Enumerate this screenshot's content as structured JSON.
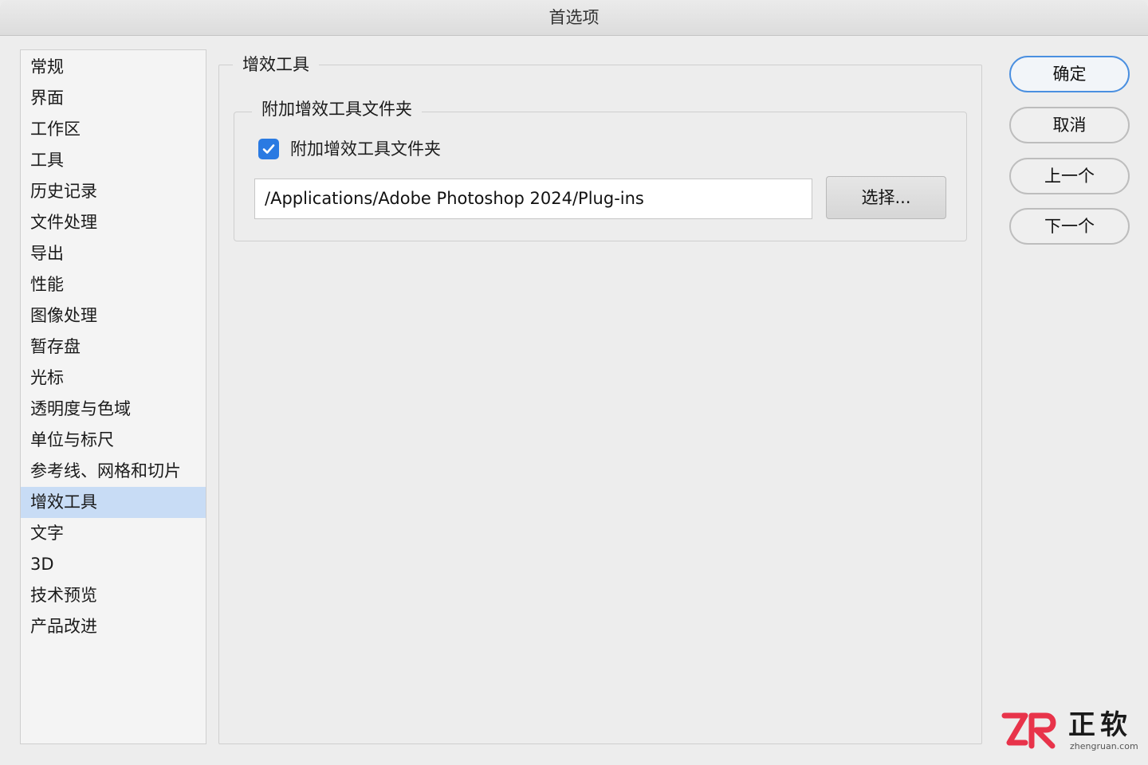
{
  "window": {
    "title": "首选项"
  },
  "sidebar": {
    "items": [
      {
        "label": "常规"
      },
      {
        "label": "界面"
      },
      {
        "label": "工作区"
      },
      {
        "label": "工具"
      },
      {
        "label": "历史记录"
      },
      {
        "label": "文件处理"
      },
      {
        "label": "导出"
      },
      {
        "label": "性能"
      },
      {
        "label": "图像处理"
      },
      {
        "label": "暂存盘"
      },
      {
        "label": "光标"
      },
      {
        "label": "透明度与色域"
      },
      {
        "label": "单位与标尺"
      },
      {
        "label": "参考线、网格和切片"
      },
      {
        "label": "增效工具"
      },
      {
        "label": "文字"
      },
      {
        "label": "3D"
      },
      {
        "label": "技术预览"
      },
      {
        "label": "产品改进"
      }
    ],
    "selected_index": 14
  },
  "main": {
    "group_title": "增效工具",
    "sub_group_title": "附加增效工具文件夹",
    "checkbox_label": "附加增效工具文件夹",
    "checkbox_checked": true,
    "path_value": "/Applications/Adobe Photoshop 2024/Plug-ins",
    "choose_button": "选择..."
  },
  "buttons": {
    "ok": "确定",
    "cancel": "取消",
    "prev": "上一个",
    "next": "下一个"
  },
  "watermark": {
    "brand": "正软",
    "url": "zhengruan.com"
  },
  "colors": {
    "accent": "#2a7ae2",
    "selection": "#c8dcf5",
    "watermark_red": "#e8334a"
  }
}
